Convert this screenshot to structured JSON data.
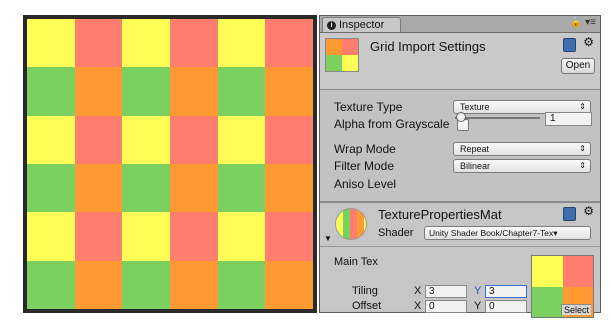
{
  "preview": {
    "grid_colors": [
      [
        "#ffff55",
        "#ff7e6e",
        "#ffff55",
        "#ff7e6e",
        "#ffff55",
        "#ff7e6e"
      ],
      [
        "#7bd15f",
        "#ff9a33",
        "#7bd15f",
        "#ff9a33",
        "#7bd15f",
        "#ff9a33"
      ],
      [
        "#ffff55",
        "#ff7e6e",
        "#ffff55",
        "#ff7e6e",
        "#ffff55",
        "#ff7e6e"
      ],
      [
        "#7bd15f",
        "#ff9a33",
        "#7bd15f",
        "#ff9a33",
        "#7bd15f",
        "#ff9a33"
      ],
      [
        "#ffff55",
        "#ff7e6e",
        "#ffff55",
        "#ff7e6e",
        "#ffff55",
        "#ff7e6e"
      ],
      [
        "#7bd15f",
        "#ff9a33",
        "#7bd15f",
        "#ff9a33",
        "#7bd15f",
        "#ff9a33"
      ]
    ]
  },
  "inspector": {
    "tab_label": "Inspector",
    "header": {
      "title": "Grid Import Settings",
      "open_label": "Open"
    },
    "props": {
      "texture_type_label": "Texture Type",
      "texture_type_value": "Texture",
      "alpha_label": "Alpha from Grayscale",
      "alpha_checked": false,
      "wrap_mode_label": "Wrap Mode",
      "wrap_mode_value": "Repeat",
      "filter_mode_label": "Filter Mode",
      "filter_mode_value": "Bilinear",
      "aniso_label": "Aniso Level",
      "aniso_value": "1"
    },
    "material": {
      "name": "TexturePropertiesMat",
      "shader_label": "Shader",
      "shader_value": "Unity Shader Book/Chapter7-Tex",
      "main_tex_label": "Main Tex",
      "tiling_label": "Tiling",
      "offset_label": "Offset",
      "x_axis": "X",
      "y_axis": "Y",
      "tiling_x": "3",
      "tiling_y": "3",
      "offset_x": "0",
      "offset_y": "0",
      "select_label": "Select"
    }
  },
  "colors": {
    "yellow": "#ffff55",
    "red": "#ff7e6e",
    "green": "#7bd15f",
    "orange": "#ff9a33"
  }
}
